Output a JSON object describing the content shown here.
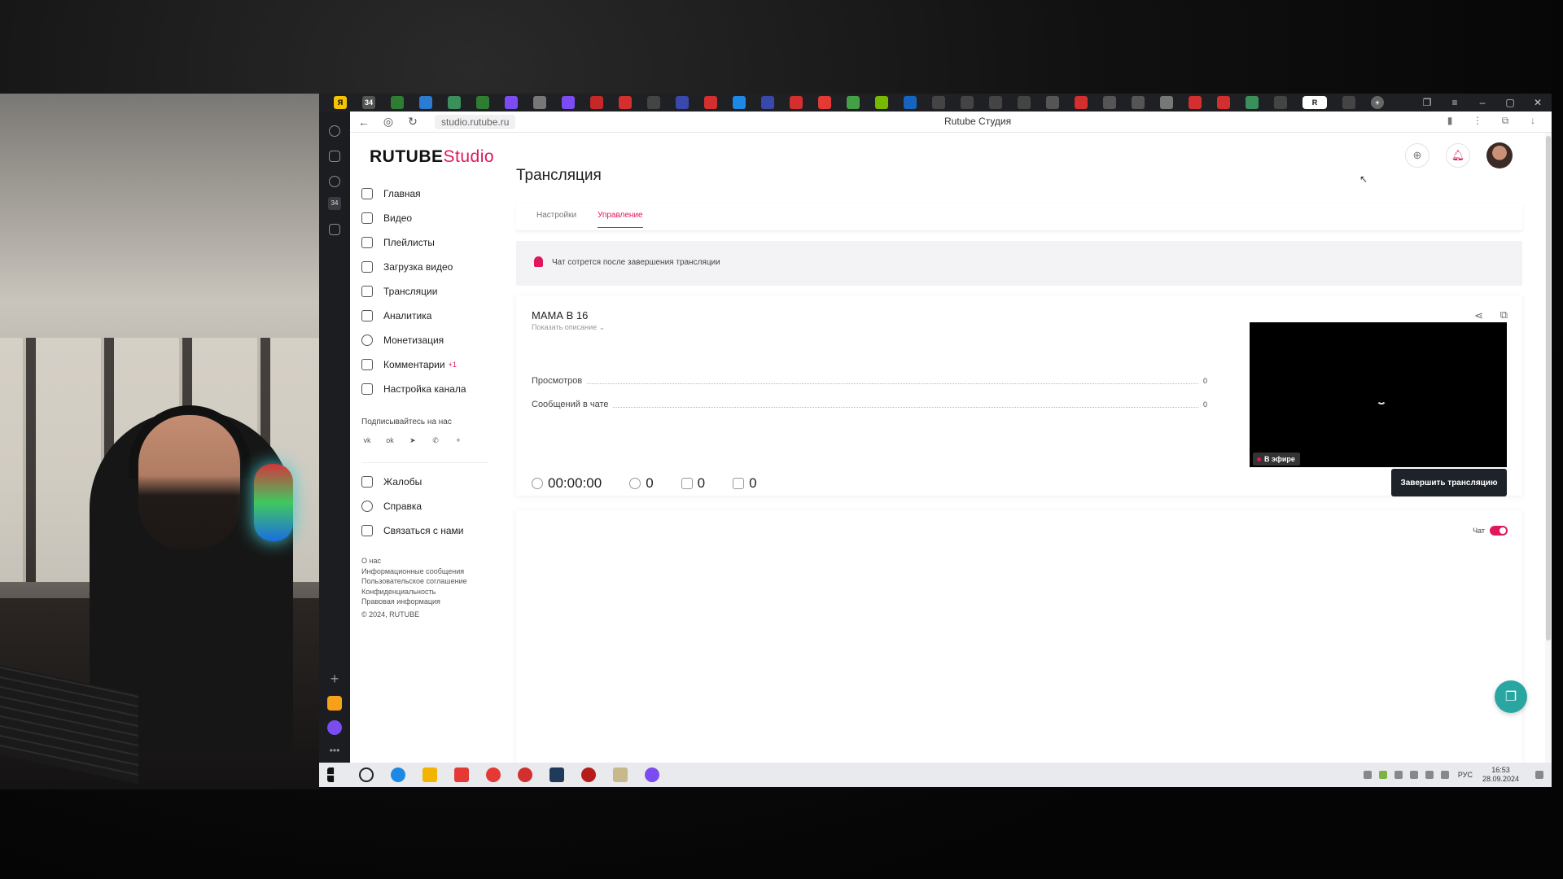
{
  "browser": {
    "url": "studio.rutube.ru",
    "page_title": "Rutube Студия",
    "left_badge": "34"
  },
  "brand": {
    "logo_main": "RUTUBE",
    "logo_sub": "Studio",
    "accent_color": "#e0175b"
  },
  "sidebar": {
    "items": [
      {
        "label": "Главная",
        "icon": "home-icon"
      },
      {
        "label": "Видео",
        "icon": "video-icon"
      },
      {
        "label": "Плейлисты",
        "icon": "playlist-icon"
      },
      {
        "label": "Загрузка видео",
        "icon": "upload-icon"
      },
      {
        "label": "Трансляции",
        "icon": "broadcast-icon"
      },
      {
        "label": "Аналитика",
        "icon": "analytics-icon"
      },
      {
        "label": "Монетизация",
        "icon": "monetization-icon"
      },
      {
        "label": "Комментарии",
        "icon": "comments-icon",
        "badge": "+1"
      },
      {
        "label": "Настройка канала",
        "icon": "channel-settings-icon"
      }
    ],
    "subscribe_label": "Подписывайтесь на нас",
    "social_icons": [
      "vk-icon",
      "ok-icon",
      "telegram-icon",
      "viber-icon",
      "plus-icon"
    ],
    "secondary_items": [
      {
        "label": "Жалобы",
        "icon": "flag-icon"
      },
      {
        "label": "Справка",
        "icon": "help-icon"
      },
      {
        "label": "Связаться с нами",
        "icon": "contact-icon"
      }
    ],
    "footer_links": [
      "О нас",
      "Информационные сообщения",
      "Пользовательское соглашение",
      "Конфиденциальность",
      "Правовая информация"
    ],
    "copyright": "© 2024, RUTUBE"
  },
  "main": {
    "title": "Трансляция",
    "tabs": [
      {
        "label": "Настройки",
        "active": false
      },
      {
        "label": "Управление",
        "active": true
      }
    ],
    "notice": "Чат сотрется после завершения трансляции",
    "stream": {
      "name": "МАМА В 16",
      "show_description": "Показать описание",
      "stats": [
        {
          "label": "Просмотров",
          "value": "0"
        },
        {
          "label": "Сообщений в чате",
          "value": "0"
        }
      ],
      "live_badge": "В эфире",
      "timer": "00:00:00",
      "viewers": "0",
      "likes": "0",
      "dislikes": "0",
      "end_button": "Завершить трансляцию"
    },
    "chat": {
      "label": "Чат",
      "enabled": true
    }
  },
  "taskbar": {
    "language": "РУС",
    "time": "16:53",
    "date": "28.09.2024"
  }
}
